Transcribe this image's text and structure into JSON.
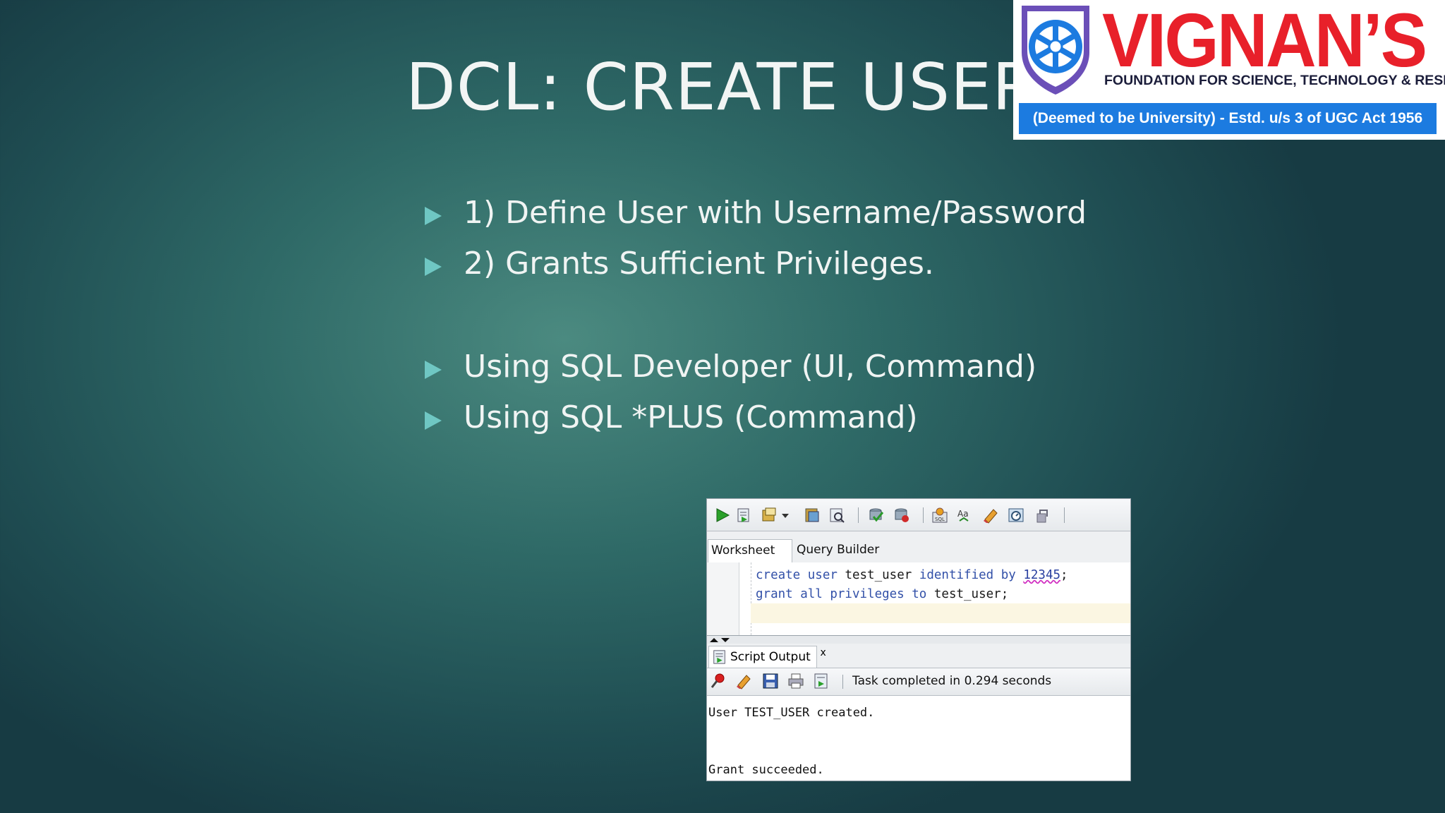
{
  "slide": {
    "title": "DCL: CREATE USER",
    "bullets": [
      "1) Define User with Username/Password",
      "2) Grants Sufficient Privileges.",
      "Using SQL Developer (UI, Command)",
      "Using SQL *PLUS (Command)"
    ],
    "bullet_color": "#6fc7c3"
  },
  "logo": {
    "brand": "VIGNAN’S",
    "subtitle": "FOUNDATION FOR SCIENCE, TECHNOLOGY & RESEARCH",
    "band": "(Deemed to be University) - Estd. u/s 3 of UGC Act 1956",
    "brand_color": "#e8202a",
    "band_color": "#1c7be0"
  },
  "sqldev": {
    "toolbar_icons": [
      "run-statement-icon",
      "run-script-icon",
      "autotrace-icon",
      "dropdown-arrow-icon",
      "explain-plan-icon",
      "sql-tuning-icon",
      "commit-icon",
      "rollback-icon",
      "sql-history-icon",
      "format-icon",
      "clear-icon",
      "sql-monitor-icon",
      "unshared-icon"
    ],
    "tabs": {
      "worksheet": "Worksheet",
      "query_builder": "Query Builder"
    },
    "code": {
      "line1": {
        "kw1": "create user",
        "ident": "test_user",
        "kw2": "identified by",
        "num": "12345",
        "end": ";"
      },
      "line2": {
        "kw1": "grant all privileges to",
        "ident": "test_user",
        "end": ";"
      }
    },
    "output_tab": {
      "label": "Script Output",
      "close": "x"
    },
    "status": "Task completed in 0.294 seconds",
    "output_lines": [
      "User TEST_USER created.",
      "Grant succeeded."
    ]
  }
}
